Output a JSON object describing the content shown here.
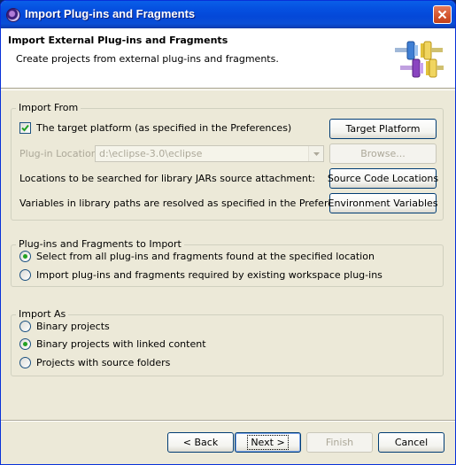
{
  "window": {
    "title": "Import Plug-ins and Fragments"
  },
  "banner": {
    "title": "Import External Plug-ins and Fragments",
    "description": "Create projects from external plug-ins and fragments."
  },
  "import_from": {
    "group_label": "Import From",
    "target_platform_checkbox": {
      "label": "The target platform (as specified in the Preferences)",
      "checked": true
    },
    "target_platform_button": "Target Platform",
    "plugin_location_label": "Plug-in Location:",
    "plugin_location_value": "d:\\eclipse-3.0\\eclipse",
    "browse_button": "Browse...",
    "library_label": "Locations to be searched for library JARs source attachment:",
    "source_code_button": "Source Code Locations",
    "variables_label": "Variables in library paths are resolved as specified in the Preferences:",
    "environment_button": "Environment Variables"
  },
  "plugins_to_import": {
    "group_label": "Plug-ins and Fragments to Import",
    "options": [
      {
        "label": "Select from all plug-ins and fragments found at the specified location",
        "selected": true
      },
      {
        "label": "Import plug-ins and fragments required by existing workspace plug-ins",
        "selected": false
      }
    ]
  },
  "import_as": {
    "group_label": "Import As",
    "options": [
      {
        "label": "Binary projects",
        "selected": false
      },
      {
        "label": "Binary projects with linked content",
        "selected": true
      },
      {
        "label": "Projects with source folders",
        "selected": false
      }
    ]
  },
  "buttons": {
    "back": "< Back",
    "next": "Next >",
    "finish": "Finish",
    "cancel": "Cancel"
  },
  "colors": {
    "titlebar": "#0550e0",
    "dialog_bg": "#ece9d8",
    "radio_dot": "#21a121"
  }
}
